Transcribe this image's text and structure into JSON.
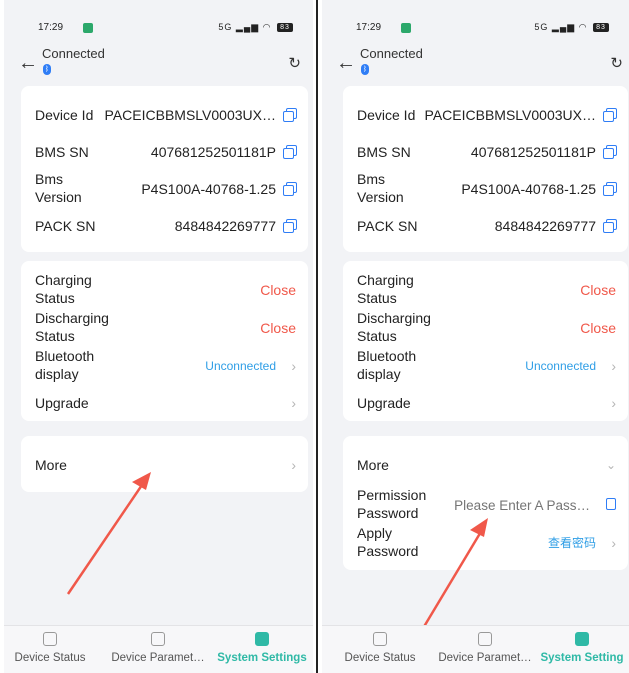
{
  "status_bar": {
    "time": "17:29",
    "signal_text": "5G",
    "battery": "83"
  },
  "header": {
    "connection_status": "Connected"
  },
  "device_info": {
    "rows": [
      {
        "label": "Device Id",
        "value": "PACEICBBMSLV0003UX…"
      },
      {
        "label": "BMS SN",
        "value": "407681252501181P"
      },
      {
        "label": "Bms Version",
        "value": "P4S100A-40768-1.25"
      },
      {
        "label": "PACK SN",
        "value": "8484842269777"
      }
    ]
  },
  "controls": {
    "charging_label": "Charging Status",
    "charging_value": "Close",
    "discharging_label": "Discharging Status",
    "discharging_value": "Close",
    "bluetooth_label": "Bluetooth display",
    "bluetooth_value": "Unconnected",
    "upgrade_label": "Upgrade"
  },
  "more": {
    "label": "More",
    "permission_label": "Permission Password",
    "password_placeholder": "Please Enter A Pass…",
    "apply_label": "Apply Password",
    "apply_value": "查看密码"
  },
  "tabs": [
    {
      "label": "Device Status"
    },
    {
      "label": "Device Paramet…"
    },
    {
      "label": "System Settings"
    }
  ],
  "tabs_right": [
    {
      "label": "Device Status"
    },
    {
      "label": "Device Paramet…"
    },
    {
      "label": "System Setting"
    }
  ],
  "colors": {
    "accent": "#2fb9a6",
    "danger": "#f0584a",
    "link": "#2f9ee6",
    "annotation_arrow": "#f0584a"
  }
}
